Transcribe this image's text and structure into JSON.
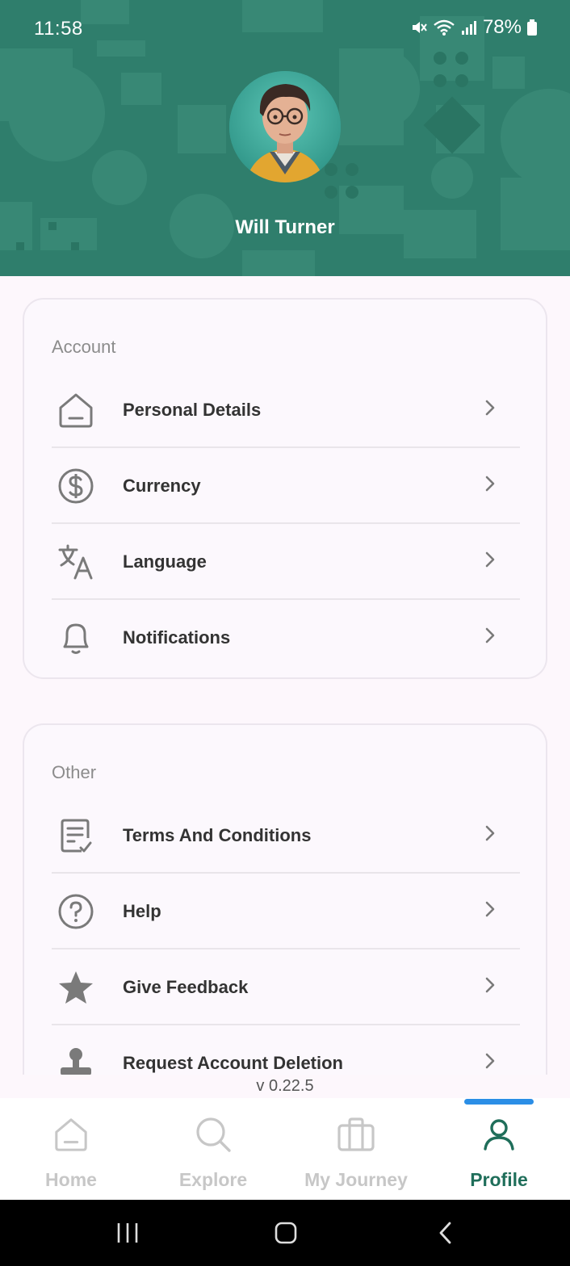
{
  "status_bar": {
    "time": "11:58",
    "battery": "78%"
  },
  "profile": {
    "name": "Will Turner"
  },
  "account_section": {
    "title": "Account",
    "items": [
      {
        "label": "Personal Details",
        "icon": "home-outline-icon"
      },
      {
        "label": "Currency",
        "icon": "dollar-circle-icon"
      },
      {
        "label": "Language",
        "icon": "translate-icon"
      },
      {
        "label": "Notifications",
        "icon": "bell-icon"
      }
    ]
  },
  "other_section": {
    "title": "Other",
    "items": [
      {
        "label": "Terms And Conditions",
        "icon": "document-check-icon"
      },
      {
        "label": "Help",
        "icon": "help-circle-icon"
      },
      {
        "label": "Give Feedback",
        "icon": "star-icon"
      },
      {
        "label": "Request Account Deletion",
        "icon": "stamp-icon"
      }
    ]
  },
  "version": "v 0.22.5",
  "bottom_nav": {
    "items": [
      {
        "label": "Home",
        "icon": "home-icon",
        "active": false
      },
      {
        "label": "Explore",
        "icon": "search-icon",
        "active": false
      },
      {
        "label": "My Journey",
        "icon": "briefcase-icon",
        "active": false
      },
      {
        "label": "Profile",
        "icon": "person-icon",
        "active": true
      }
    ]
  },
  "colors": {
    "header_bg": "#2f7e6c",
    "accent": "#1f6e5a",
    "indicator": "#2b8ee6",
    "page_bg": "#fdf7fc"
  }
}
